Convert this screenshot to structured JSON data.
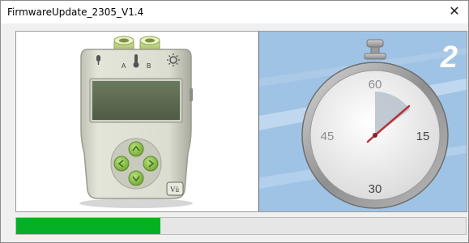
{
  "window": {
    "title": "FirmwareUpdate_2305_V1.4",
    "close_icon": "close-icon"
  },
  "device": {
    "port_a_label": "A",
    "port_b_label": "B",
    "logo_text": "Vü"
  },
  "timer": {
    "step_number": "2",
    "dial_labels": {
      "top": "60",
      "right": "15",
      "bottom": "30",
      "left": "45"
    }
  },
  "progress": {
    "value_fraction": 0.32,
    "fill_color": "#06b025"
  },
  "colors": {
    "timer_background": "#9fc3e4",
    "device_body": "#d9d9cc",
    "device_screen": "#5d6b52",
    "device_buttons": "#8ac04a"
  }
}
